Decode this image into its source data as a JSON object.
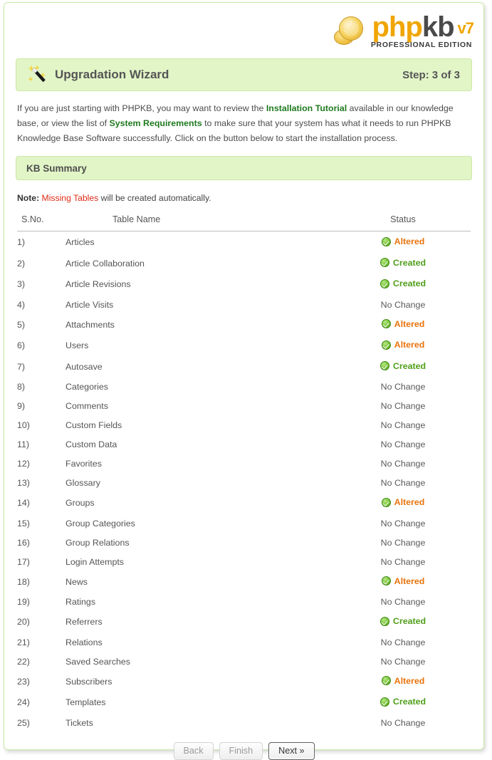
{
  "branding": {
    "word_php": "php",
    "word_kb": "kb",
    "version": "v7",
    "edition": "PROFESSIONAL EDITION",
    "logo_icon": "coin-stack-icon"
  },
  "wizard": {
    "icon": "magic-wand-icon",
    "title": "Upgradation Wizard",
    "step": "Step: 3 of 3"
  },
  "intro": {
    "part1": "If you are just starting with PHPKB, you may want to review the ",
    "link1": "Installation Tutorial",
    "part2": " available in our knowledge base, or view the list of ",
    "link2": "System Requirements",
    "part3": " to make sure that your system has what it needs to run PHPKB Knowledge Base Software successfully. Click on the button below to start the installation process."
  },
  "summary": {
    "heading": "KB Summary",
    "note_label": "Note:",
    "note_red": " Missing Tables",
    "note_rest": " will be created automatically."
  },
  "table": {
    "headers": {
      "sno": "S.No.",
      "name": "Table Name",
      "status": "Status"
    },
    "rows": [
      {
        "sno": "1)",
        "name": "Articles",
        "status": "Altered",
        "type": "altered"
      },
      {
        "sno": "2)",
        "name": "Article Collaboration",
        "status": "Created",
        "type": "created"
      },
      {
        "sno": "3)",
        "name": "Article Revisions",
        "status": "Created",
        "type": "created"
      },
      {
        "sno": "4)",
        "name": "Article Visits",
        "status": "No Change",
        "type": "nochange"
      },
      {
        "sno": "5)",
        "name": "Attachments",
        "status": "Altered",
        "type": "altered"
      },
      {
        "sno": "6)",
        "name": "Users",
        "status": "Altered",
        "type": "altered"
      },
      {
        "sno": "7)",
        "name": "Autosave",
        "status": "Created",
        "type": "created"
      },
      {
        "sno": "8)",
        "name": "Categories",
        "status": "No Change",
        "type": "nochange"
      },
      {
        "sno": "9)",
        "name": "Comments",
        "status": "No Change",
        "type": "nochange"
      },
      {
        "sno": "10)",
        "name": "Custom Fields",
        "status": "No Change",
        "type": "nochange"
      },
      {
        "sno": "11)",
        "name": "Custom Data",
        "status": "No Change",
        "type": "nochange"
      },
      {
        "sno": "12)",
        "name": "Favorites",
        "status": "No Change",
        "type": "nochange"
      },
      {
        "sno": "13)",
        "name": "Glossary",
        "status": "No Change",
        "type": "nochange"
      },
      {
        "sno": "14)",
        "name": "Groups",
        "status": "Altered",
        "type": "altered"
      },
      {
        "sno": "15)",
        "name": "Group Categories",
        "status": "No Change",
        "type": "nochange"
      },
      {
        "sno": "16)",
        "name": "Group Relations",
        "status": "No Change",
        "type": "nochange"
      },
      {
        "sno": "17)",
        "name": "Login Attempts",
        "status": "No Change",
        "type": "nochange"
      },
      {
        "sno": "18)",
        "name": "News",
        "status": "Altered",
        "type": "altered"
      },
      {
        "sno": "19)",
        "name": "Ratings",
        "status": "No Change",
        "type": "nochange"
      },
      {
        "sno": "20)",
        "name": "Referrers",
        "status": "Created",
        "type": "created"
      },
      {
        "sno": "21)",
        "name": "Relations",
        "status": "No Change",
        "type": "nochange"
      },
      {
        "sno": "22)",
        "name": "Saved Searches",
        "status": "No Change",
        "type": "nochange"
      },
      {
        "sno": "23)",
        "name": "Subscribers",
        "status": "Altered",
        "type": "altered"
      },
      {
        "sno": "24)",
        "name": "Templates",
        "status": "Created",
        "type": "created"
      },
      {
        "sno": "25)",
        "name": "Tickets",
        "status": "No Change",
        "type": "nochange"
      }
    ]
  },
  "buttons": {
    "back": "Back",
    "finish": "Finish",
    "next": "Next »"
  },
  "colors": {
    "panel_green_bg": "#e2f5c7",
    "panel_green_border": "#cbe7a6",
    "brand_orange": "#f0a500",
    "status_altered": "#e8730c",
    "status_created": "#4f9e1a",
    "status_nochange": "#5a5a5a",
    "note_red": "#e02b15",
    "link_green": "#1f7a1f"
  }
}
